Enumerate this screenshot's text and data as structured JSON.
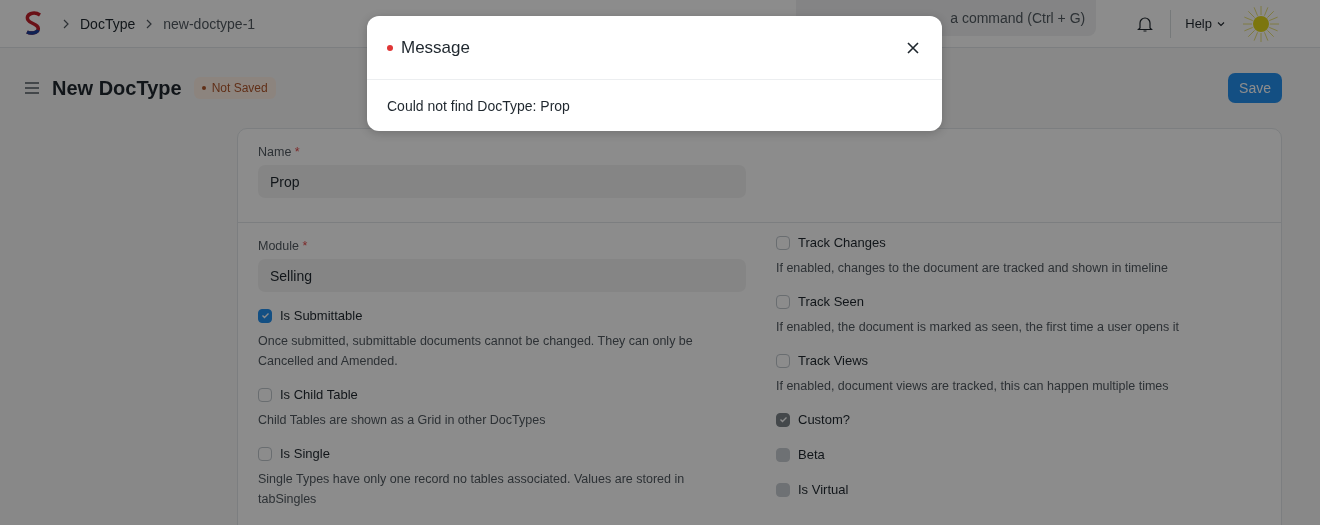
{
  "navbar": {
    "breadcrumbs": [
      "DocType",
      "new-doctype-1"
    ],
    "search": {
      "placeholder": "a command (Ctrl + G)"
    },
    "help": "Help"
  },
  "page_head": {
    "title": "New DocType",
    "status": "Not Saved",
    "save": "Save"
  },
  "form": {
    "name_field": {
      "label": "Name",
      "required_mark": "*",
      "value": "Prop"
    },
    "module_field": {
      "label": "Module",
      "required_mark": "*",
      "value": "Selling"
    },
    "left_checks": [
      {
        "label": "Is Submittable",
        "checked": true,
        "disabled": false,
        "description": "Once submitted, submittable documents cannot be changed. They can only be Cancelled and Amended."
      },
      {
        "label": "Is Child Table",
        "checked": false,
        "disabled": false,
        "description": "Child Tables are shown as a Grid in other DocTypes"
      },
      {
        "label": "Is Single",
        "checked": false,
        "disabled": false,
        "description": "Single Types have only one record no tables associated. Values are stored in tabSingles"
      }
    ],
    "right_checks": [
      {
        "label": "Track Changes",
        "checked": false,
        "disabled": false,
        "description": "If enabled, changes to the document are tracked and shown in timeline"
      },
      {
        "label": "Track Seen",
        "checked": false,
        "disabled": false,
        "description": "If enabled, the document is marked as seen, the first time a user opens it"
      },
      {
        "label": "Track Views",
        "checked": false,
        "disabled": false,
        "description": "If enabled, document views are tracked, this can happen multiple times"
      },
      {
        "label": "Custom?",
        "checked": true,
        "disabled": true
      },
      {
        "label": "Beta",
        "checked": false,
        "disabled": true
      },
      {
        "label": "Is Virtual",
        "checked": false,
        "disabled": true
      }
    ]
  },
  "dialog": {
    "title": "Message",
    "message": "Could not find DocType: Prop"
  }
}
